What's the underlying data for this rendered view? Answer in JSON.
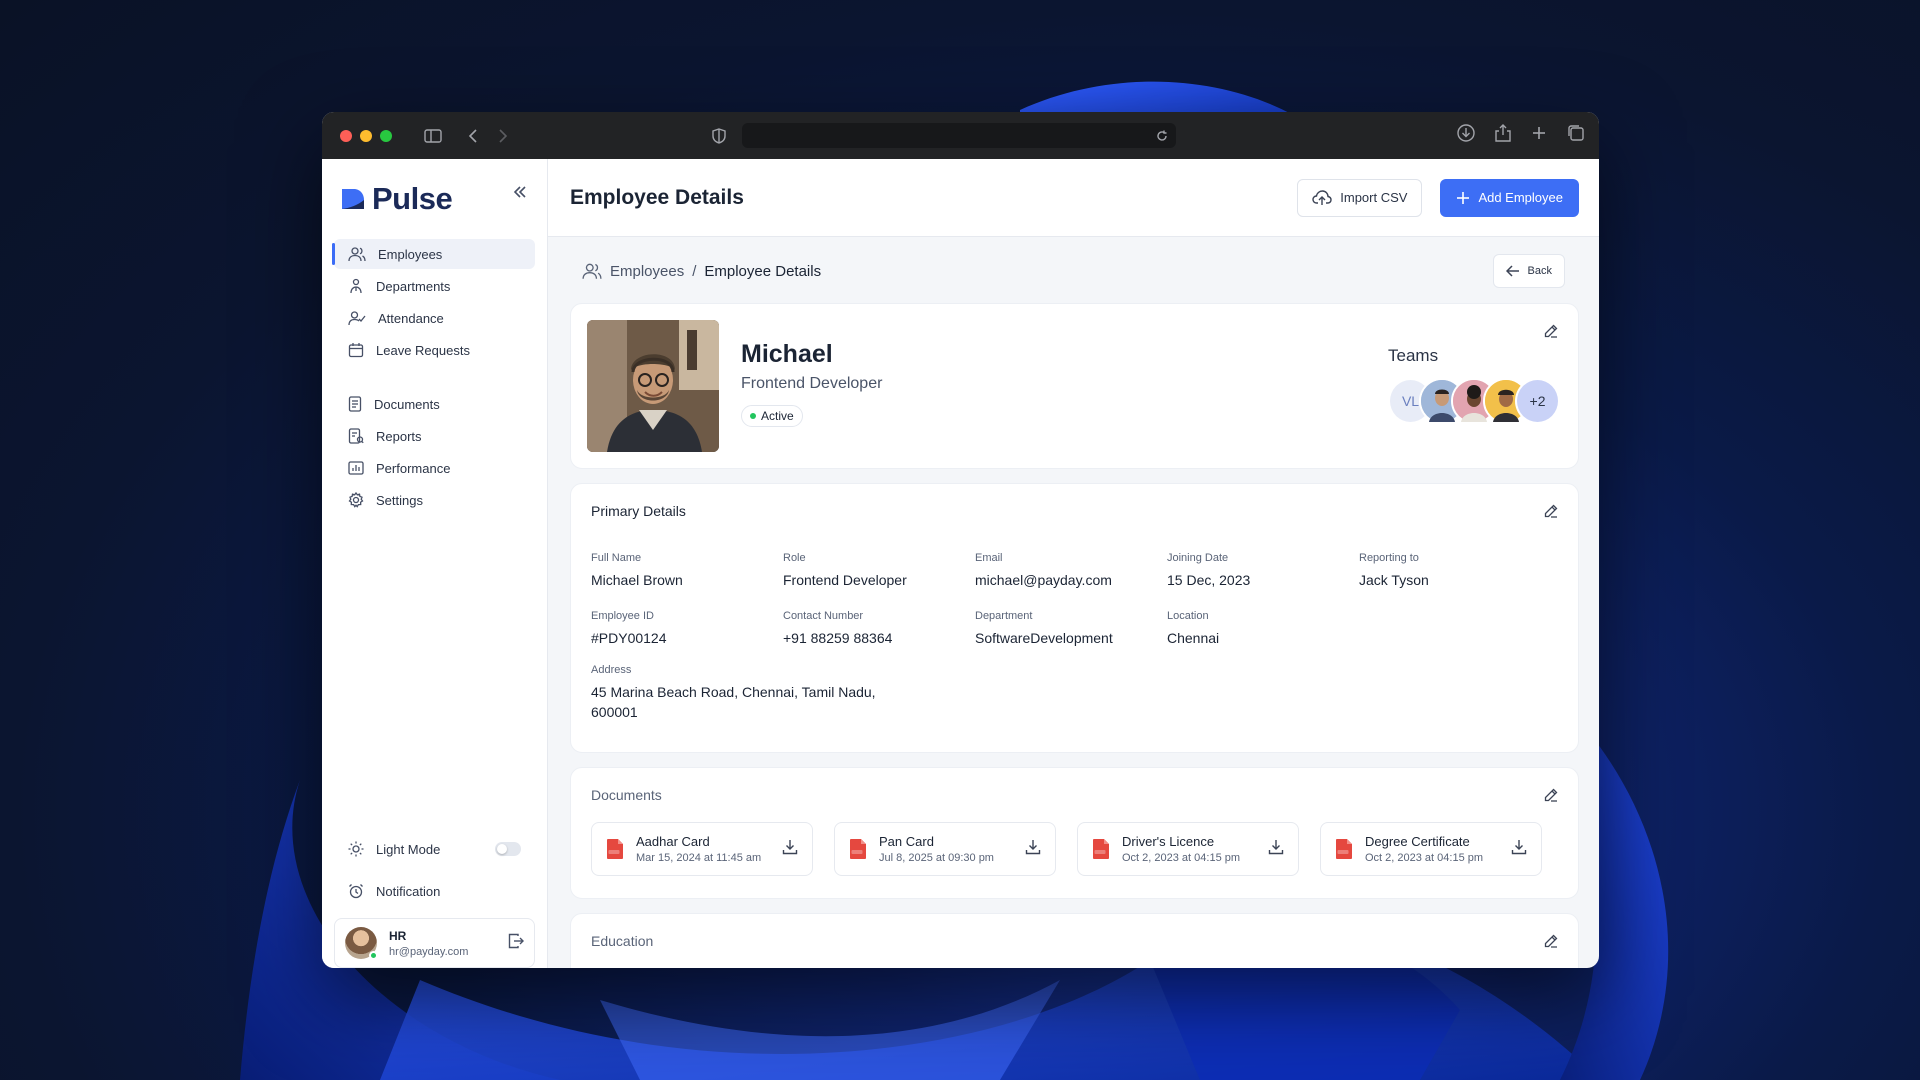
{
  "app": {
    "brand": "Pulse",
    "page_title": "Employee Details",
    "import_label": "Import CSV",
    "add_label": "Add Employee"
  },
  "sidebar": {
    "items": [
      {
        "label": "Employees",
        "icon": "users-icon",
        "active": true
      },
      {
        "label": "Departments",
        "icon": "sitemap-icon"
      },
      {
        "label": "Attendance",
        "icon": "user-check-icon"
      },
      {
        "label": "Leave Requests",
        "icon": "calendar-icon"
      },
      {
        "label": "Documents",
        "icon": "document-icon"
      },
      {
        "label": "Reports",
        "icon": "report-icon"
      },
      {
        "label": "Performance",
        "icon": "chart-icon"
      },
      {
        "label": "Settings",
        "icon": "gear-icon"
      }
    ],
    "light_mode_label": "Light Mode",
    "light_mode_on": false,
    "notification_label": "Notification",
    "user": {
      "name": "HR",
      "email": "hr@payday.com"
    }
  },
  "breadcrumb": {
    "root": "Employees",
    "separator": "/",
    "current": "Employee Details"
  },
  "back_label": "Back",
  "profile": {
    "name": "Michael",
    "role": "Frontend Developer",
    "status": "Active",
    "teams_title": "Teams",
    "teams": [
      {
        "initials": "VL",
        "color": "#e8ecf7"
      },
      {
        "initials": "",
        "color": "#9fb7d9"
      },
      {
        "initials": "",
        "color": "#e2a4b0"
      },
      {
        "initials": "",
        "color": "#f2c04a"
      },
      {
        "initials": "+2",
        "color": "#c9d2f7"
      }
    ]
  },
  "primary_details": {
    "title": "Primary Details",
    "fields": [
      {
        "label": "Full Name",
        "value": "Michael Brown"
      },
      {
        "label": "Role",
        "value": "Frontend Developer"
      },
      {
        "label": "Email",
        "value": "michael@payday.com"
      },
      {
        "label": "Joining Date",
        "value": "15 Dec, 2023"
      },
      {
        "label": "Reporting to",
        "value": "Jack Tyson"
      },
      {
        "label": "Employee ID",
        "value": "#PDY00124"
      },
      {
        "label": "Contact Number",
        "value": "+91 88259 88364"
      },
      {
        "label": "Department",
        "value": "SoftwareDevelopment"
      },
      {
        "label": "Location",
        "value": "Chennai"
      }
    ],
    "address_label": "Address",
    "address_value": "45 Marina Beach Road, Chennai, Tamil Nadu, 600001"
  },
  "documents": {
    "title": "Documents",
    "items": [
      {
        "name": "Aadhar Card",
        "date": "Mar 15, 2024 at 11:45 am"
      },
      {
        "name": "Pan Card",
        "date": "Jul 8, 2025 at 09:30 pm"
      },
      {
        "name": "Driver's Licence",
        "date": "Oct 2, 2023 at 04:15 pm"
      },
      {
        "name": "Degree Certificate",
        "date": "Oct 2, 2023 at 04:15 pm"
      }
    ]
  },
  "education": {
    "title": "Education"
  },
  "colors": {
    "accent": "#3d6ef5",
    "status_active": "#22c55e",
    "pdf": "#e5483f"
  }
}
